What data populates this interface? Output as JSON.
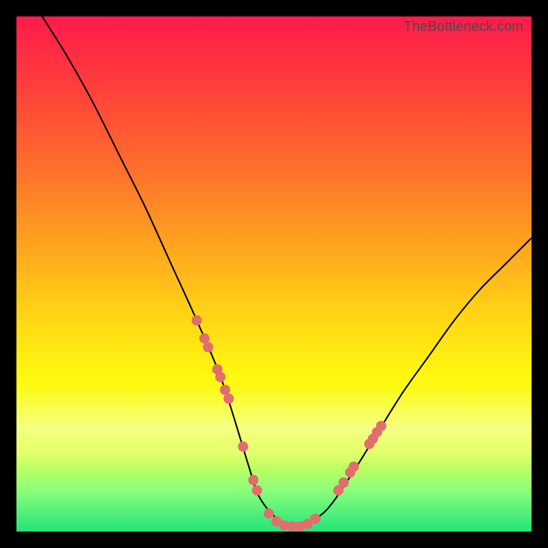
{
  "watermark": "TheBottleneck.com",
  "chart_data": {
    "type": "line",
    "title": "",
    "xlabel": "",
    "ylabel": "",
    "xlim": [
      0,
      100
    ],
    "ylim": [
      0,
      100
    ],
    "grid": false,
    "legend": false,
    "series": [
      {
        "name": "curve",
        "x": [
          5,
          10,
          15,
          20,
          25,
          30,
          35,
          40,
          45,
          47,
          50,
          53,
          55,
          60,
          65,
          70,
          75,
          80,
          85,
          90,
          95,
          100
        ],
        "y": [
          100,
          92,
          83,
          73,
          63,
          52,
          41,
          29,
          13,
          7,
          3,
          1,
          1,
          4,
          11,
          19,
          27,
          34,
          41,
          47,
          52,
          57
        ]
      }
    ],
    "markers": [
      {
        "x": 35.0,
        "y": 41.0
      },
      {
        "x": 36.5,
        "y": 37.5
      },
      {
        "x": 37.2,
        "y": 35.8
      },
      {
        "x": 39.0,
        "y": 31.5
      },
      {
        "x": 39.6,
        "y": 30.0
      },
      {
        "x": 40.5,
        "y": 27.5
      },
      {
        "x": 41.2,
        "y": 25.8
      },
      {
        "x": 44.0,
        "y": 16.5
      },
      {
        "x": 46.0,
        "y": 10.0
      },
      {
        "x": 46.7,
        "y": 8.0
      },
      {
        "x": 49.0,
        "y": 3.5
      },
      {
        "x": 50.5,
        "y": 2.0
      },
      {
        "x": 52.0,
        "y": 1.2
      },
      {
        "x": 53.5,
        "y": 1.0
      },
      {
        "x": 55.0,
        "y": 1.0
      },
      {
        "x": 56.5,
        "y": 1.5
      },
      {
        "x": 58.0,
        "y": 2.5
      },
      {
        "x": 62.5,
        "y": 8.0
      },
      {
        "x": 63.5,
        "y": 9.5
      },
      {
        "x": 64.8,
        "y": 11.5
      },
      {
        "x": 65.5,
        "y": 12.6
      },
      {
        "x": 68.5,
        "y": 17.0
      },
      {
        "x": 69.2,
        "y": 18.0
      },
      {
        "x": 70.0,
        "y": 19.3
      },
      {
        "x": 70.8,
        "y": 20.5
      }
    ]
  }
}
